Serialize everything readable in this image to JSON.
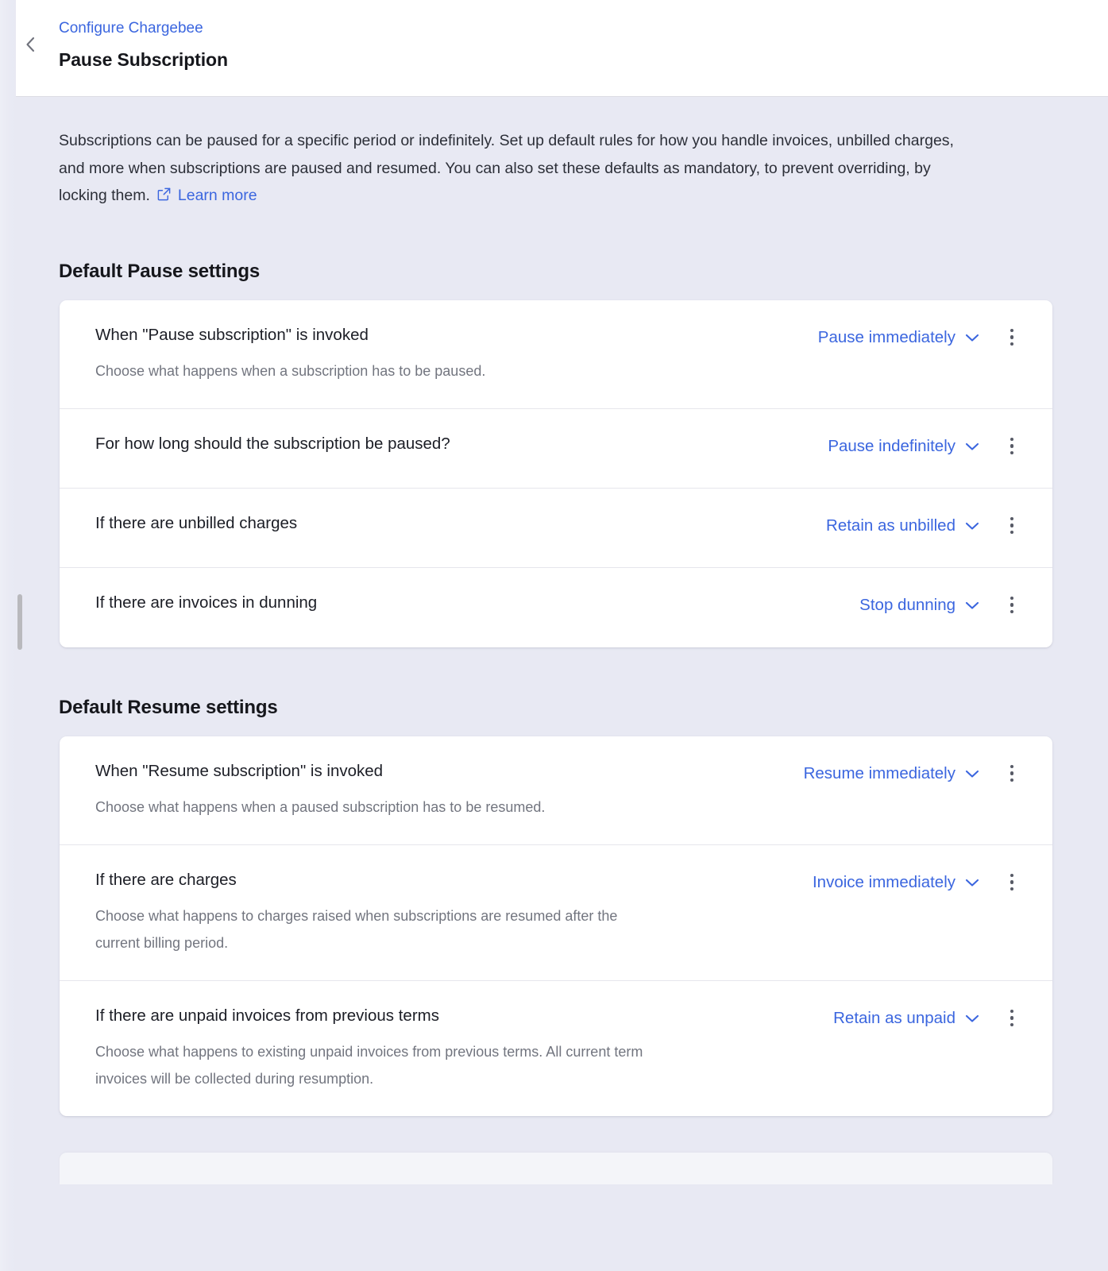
{
  "header": {
    "back_icon": "chevron-left-icon",
    "breadcrumb": "Configure Chargebee",
    "title": "Pause Subscription"
  },
  "intro": {
    "text": "Subscriptions can be paused for a specific period or indefinitely. Set up default rules for how you handle invoices, unbilled charges, and more when subscriptions are paused and resumed. You can also set these defaults as mandatory, to prevent overriding, by locking them.",
    "external_link_icon": "external-link-icon",
    "learn_more": "Learn more"
  },
  "colors": {
    "accent_blue": "#3b66df",
    "page_background": "#e8e9f3",
    "card_background": "#ffffff",
    "heading_text": "#16171c",
    "muted_text": "#72757f",
    "divider": "#e6e6ec"
  },
  "sections": [
    {
      "title": "Default Pause settings",
      "rows": [
        {
          "label": "When \"Pause subscription\" is invoked",
          "description": "Choose what happens when a subscription has to be paused.",
          "value": "Pause immediately",
          "chevron_icon": "chevron-down-icon",
          "menu_icon": "kebab-menu-icon"
        },
        {
          "label": "For how long should the subscription be paused?",
          "description": "",
          "value": "Pause indefinitely",
          "chevron_icon": "chevron-down-icon",
          "menu_icon": "kebab-menu-icon"
        },
        {
          "label": "If there are unbilled charges",
          "description": "",
          "value": "Retain as unbilled",
          "chevron_icon": "chevron-down-icon",
          "menu_icon": "kebab-menu-icon"
        },
        {
          "label": "If there are invoices in dunning",
          "description": "",
          "value": "Stop dunning",
          "chevron_icon": "chevron-down-icon",
          "menu_icon": "kebab-menu-icon"
        }
      ]
    },
    {
      "title": "Default Resume settings",
      "rows": [
        {
          "label": "When \"Resume subscription\" is invoked",
          "description": "Choose what happens when a paused subscription has to be resumed.",
          "value": "Resume immediately",
          "chevron_icon": "chevron-down-icon",
          "menu_icon": "kebab-menu-icon"
        },
        {
          "label": "If there are charges",
          "description": "Choose what happens to charges raised when subscriptions are resumed after the current billing period.",
          "value": "Invoice immediately",
          "chevron_icon": "chevron-down-icon",
          "menu_icon": "kebab-menu-icon"
        },
        {
          "label": "If there are unpaid invoices from previous terms",
          "description": "Choose what happens to existing unpaid invoices from previous terms. All current term invoices will be collected during resumption.",
          "value": "Retain as unpaid",
          "chevron_icon": "chevron-down-icon",
          "menu_icon": "kebab-menu-icon"
        }
      ]
    }
  ],
  "scrollbar": {
    "name": "vertical-scrollbar"
  }
}
